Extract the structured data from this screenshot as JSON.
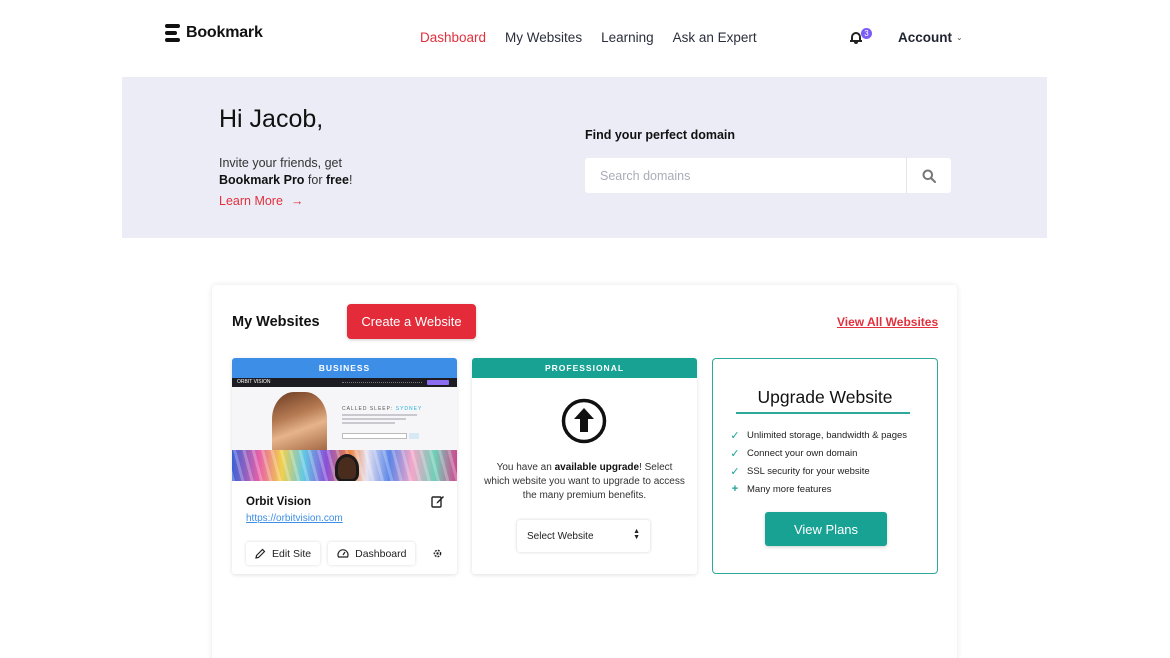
{
  "nav": {
    "logo_text": "Bookmark",
    "links": [
      {
        "label": "Dashboard",
        "active": true
      },
      {
        "label": "My Websites",
        "active": false
      },
      {
        "label": "Learning",
        "active": false
      },
      {
        "label": "Ask an Expert",
        "active": false
      }
    ],
    "notification_count": "3",
    "account_label": "Account",
    "chevron_icon": "chevron-down-icon",
    "bell_icon": "bell-icon"
  },
  "hero": {
    "greeting": "Hi Jacob,",
    "invite_line1": "Invite your friends, get",
    "invite_brand": "Bookmark Pro",
    "invite_for": " for ",
    "invite_free": "free",
    "invite_end": "!",
    "learn_more": "Learn More",
    "learn_more_arrow": "→",
    "domain_label": "Find your perfect domain",
    "domain_placeholder": "Search domains",
    "search_icon": "search-icon"
  },
  "websites": {
    "title": "My Websites",
    "create_button": "Create a Website",
    "view_all": "View All Websites",
    "site_card": {
      "tier": "BUSINESS",
      "preview_logo": "ORBIT VISION",
      "preview_headline_prefix": "CALLED SLEEP: ",
      "preview_headline_accent": "SYDNEY",
      "name": "Orbit Vision",
      "url": "https://orbitvision.com",
      "edit_site": "Edit Site",
      "dashboard": "Dashboard"
    },
    "pro_card": {
      "tier": "PROFESSIONAL",
      "text_prefix": "You have an ",
      "text_bold": "available upgrade",
      "text_suffix": "! Select which website you want to upgrade to access the many premium benefits.",
      "select_placeholder": "Select Website"
    },
    "upgrade_card": {
      "title": "Upgrade Website",
      "features": [
        {
          "icon": "check-icon",
          "text": "Unlimited storage, bandwidth & pages"
        },
        {
          "icon": "check-icon",
          "text": "Connect your own domain"
        },
        {
          "icon": "check-icon",
          "text": "SSL security for your website"
        },
        {
          "icon": "plus-icon",
          "text": "Many more features"
        }
      ],
      "button": "View Plans"
    }
  },
  "colors": {
    "accent_red": "#e32b3a",
    "teal": "#18a294",
    "blue": "#3d8ee6",
    "badge_purple": "#7b5cf5",
    "hero_bg": "#ebecf5"
  }
}
